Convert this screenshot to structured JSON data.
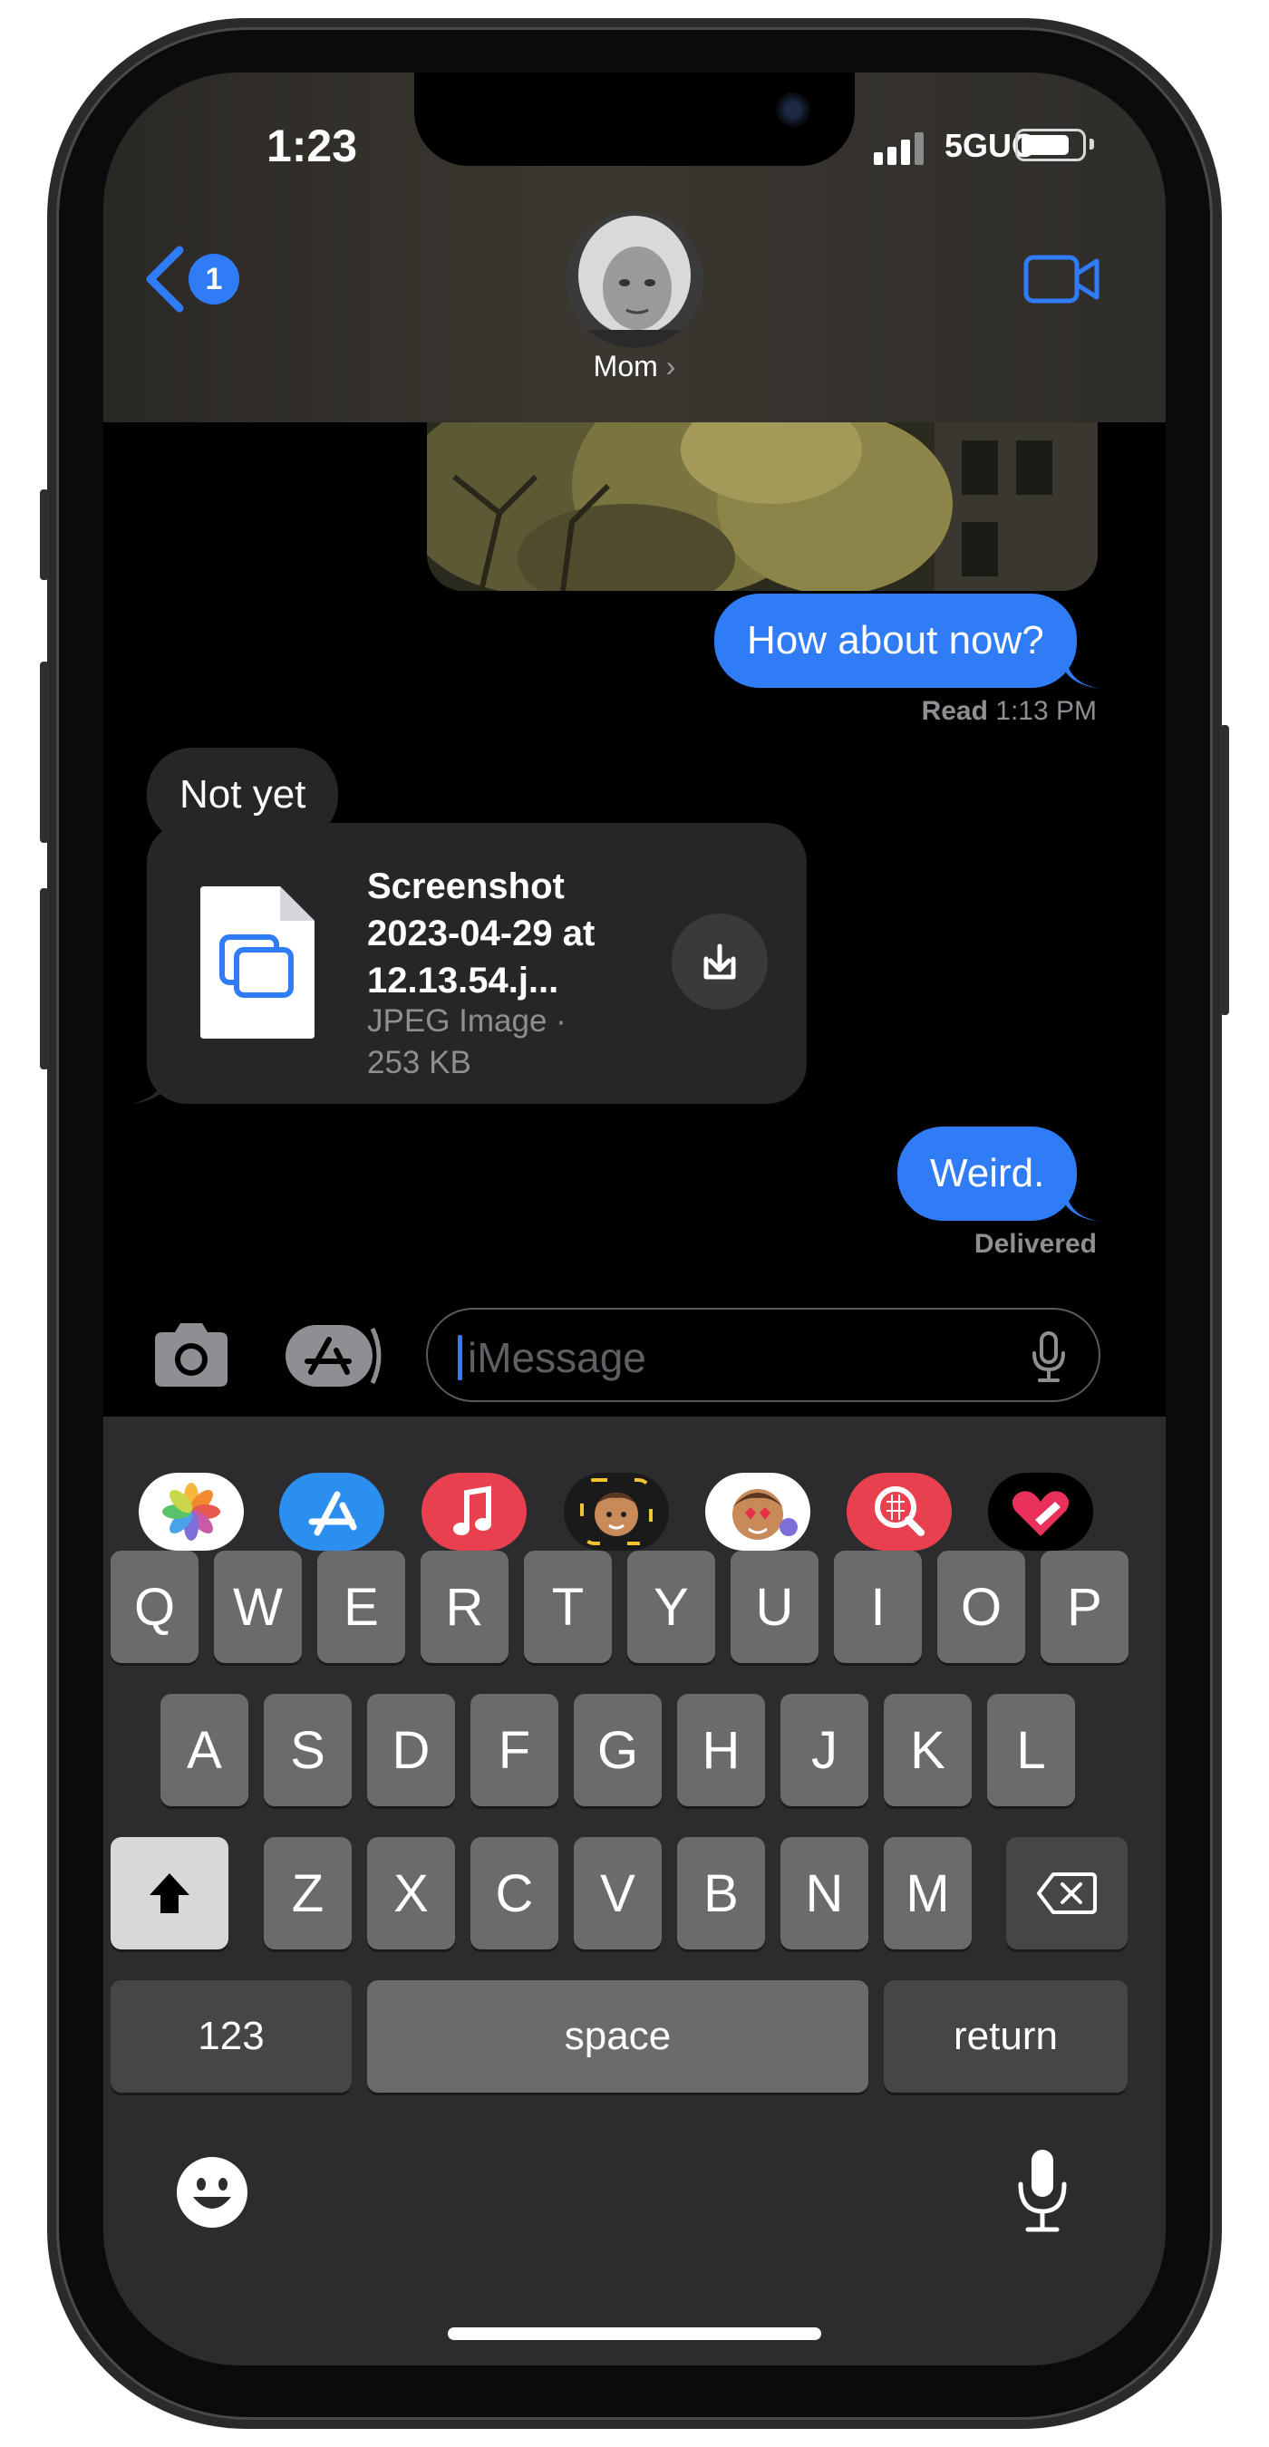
{
  "status_bar": {
    "time": "1:23",
    "network": "5GUC"
  },
  "header": {
    "back_badge": "1",
    "contact_name": "Mom",
    "contact_chevron": "›"
  },
  "messages": {
    "sent_1": "How about now?",
    "sent_1_read_label": "Read",
    "sent_1_read_time": "1:13 PM",
    "received_1": "Not yet",
    "attachment": {
      "name": "Screenshot 2023-04-29 at 12.13.54.j...",
      "type_size": "JPEG Image · 253 KB"
    },
    "sent_2": "Weird.",
    "sent_2_status": "Delivered"
  },
  "input": {
    "placeholder": "iMessage"
  },
  "app_drawer": [
    "photos-app",
    "app-store-app",
    "music-app",
    "memoji-app",
    "animoji-stickers-app",
    "image-search-app",
    "digital-touch-app"
  ],
  "keyboard": {
    "row1": [
      "Q",
      "W",
      "E",
      "R",
      "T",
      "Y",
      "U",
      "I",
      "O",
      "P"
    ],
    "row2": [
      "A",
      "S",
      "D",
      "F",
      "G",
      "H",
      "J",
      "K",
      "L"
    ],
    "row3": [
      "Z",
      "X",
      "C",
      "V",
      "B",
      "N",
      "M"
    ],
    "numbers_key": "123",
    "space_key": "space",
    "return_key": "return"
  },
  "colors": {
    "accent": "#2f7cf6",
    "received_bubble": "#262628",
    "keyboard_bg": "#2c2c2e"
  }
}
